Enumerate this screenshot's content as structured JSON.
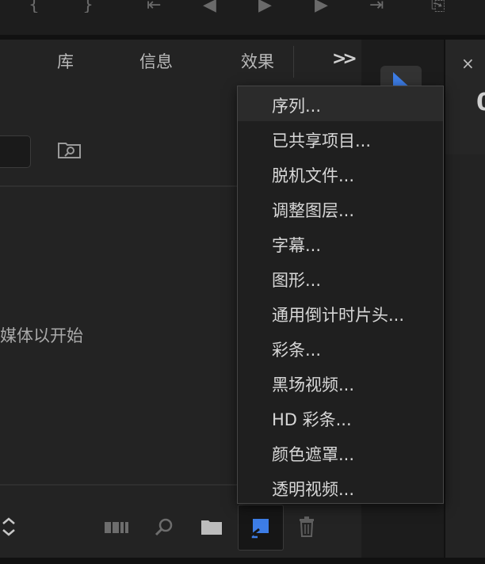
{
  "tabs": [
    "库",
    "信息",
    "效果"
  ],
  "overflow_icon": "double-chevron-right",
  "hint_text": "媒体以开始",
  "close_label": "×",
  "right_panel_partial": "0",
  "menu_items": [
    "序列...",
    "已共享项目...",
    "脱机文件...",
    "调整图层...",
    "字幕...",
    "图形...",
    "通用倒计时片头...",
    "彩条...",
    "黑场视频...",
    "HD 彩条...",
    "颜色遮罩...",
    "透明视频..."
  ],
  "colors": {
    "accent": "#3d7de6",
    "panel": "#232323",
    "menu_bg": "#1f1f1f"
  },
  "icons": [
    "search-bin-icon",
    "sort-arrows-icon",
    "freeform-view-icon",
    "find-icon",
    "new-bin-icon",
    "new-item-icon",
    "trash-icon"
  ]
}
